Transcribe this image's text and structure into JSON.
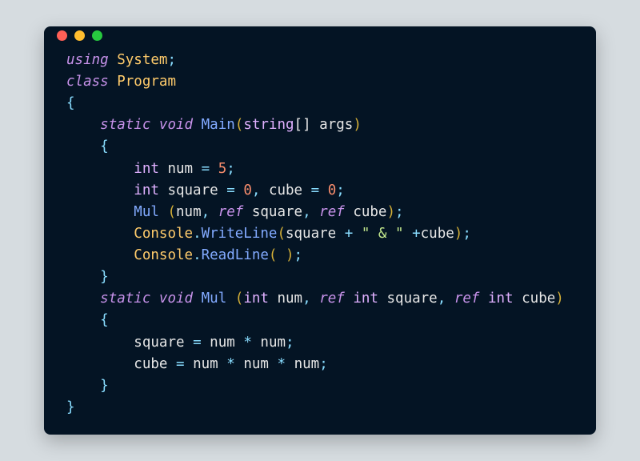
{
  "code": {
    "lines": {
      "l1_kw_using": "using",
      "l1_ns": "System",
      "l2_kw_class": "class",
      "l2_name": "Program",
      "l3_brace": "{",
      "l4_kw_static": "static",
      "l4_kw_void": "void",
      "l4_fn": "Main",
      "l4_param_type": "string",
      "l4_brackets": "[]",
      "l4_param": "args",
      "l5_brace": "{",
      "l6_type": "int",
      "l6_var": "num",
      "l6_eq": "=",
      "l6_val": "5",
      "l7_type": "int",
      "l7_var1": "square",
      "l7_eq1": "=",
      "l7_val1": "0",
      "l7_comma": ",",
      "l7_var2": "cube",
      "l7_eq2": "=",
      "l7_val2": "0",
      "l8_fn": "Mul",
      "l8_arg1": "num",
      "l8_kw_ref1": "ref",
      "l8_arg2": "square",
      "l8_kw_ref2": "ref",
      "l8_arg3": "cube",
      "l9_cls": "Console",
      "l9_fn": "WriteLine",
      "l9_arg1": "square",
      "l9_plus1": "+",
      "l9_str": "\" & \"",
      "l9_plus2": "+",
      "l9_arg2": "cube",
      "l10_cls": "Console",
      "l10_fn": "ReadLine",
      "l11_brace": "}",
      "l12_kw_static": "static",
      "l12_kw_void": "void",
      "l12_fn": "Mul",
      "l12_t1": "int",
      "l12_p1": "num",
      "l12_ref1": "ref",
      "l12_t2": "int",
      "l12_p2": "square",
      "l12_ref2": "ref",
      "l12_t3": "int",
      "l12_p3": "cube",
      "l13_brace": "{",
      "l14_var": "square",
      "l14_eq": "=",
      "l14_a": "num",
      "l14_op": "*",
      "l14_b": "num",
      "l15_var": "cube",
      "l15_eq": "=",
      "l15_a": "num",
      "l15_op1": "*",
      "l15_b": "num",
      "l15_op2": "*",
      "l15_c": "num",
      "l16_brace": "}",
      "l17_brace": "}"
    }
  },
  "colors": {
    "bg": "#041424",
    "red": "#ff5f56",
    "yellow": "#ffbd2e",
    "green": "#27c93f"
  }
}
